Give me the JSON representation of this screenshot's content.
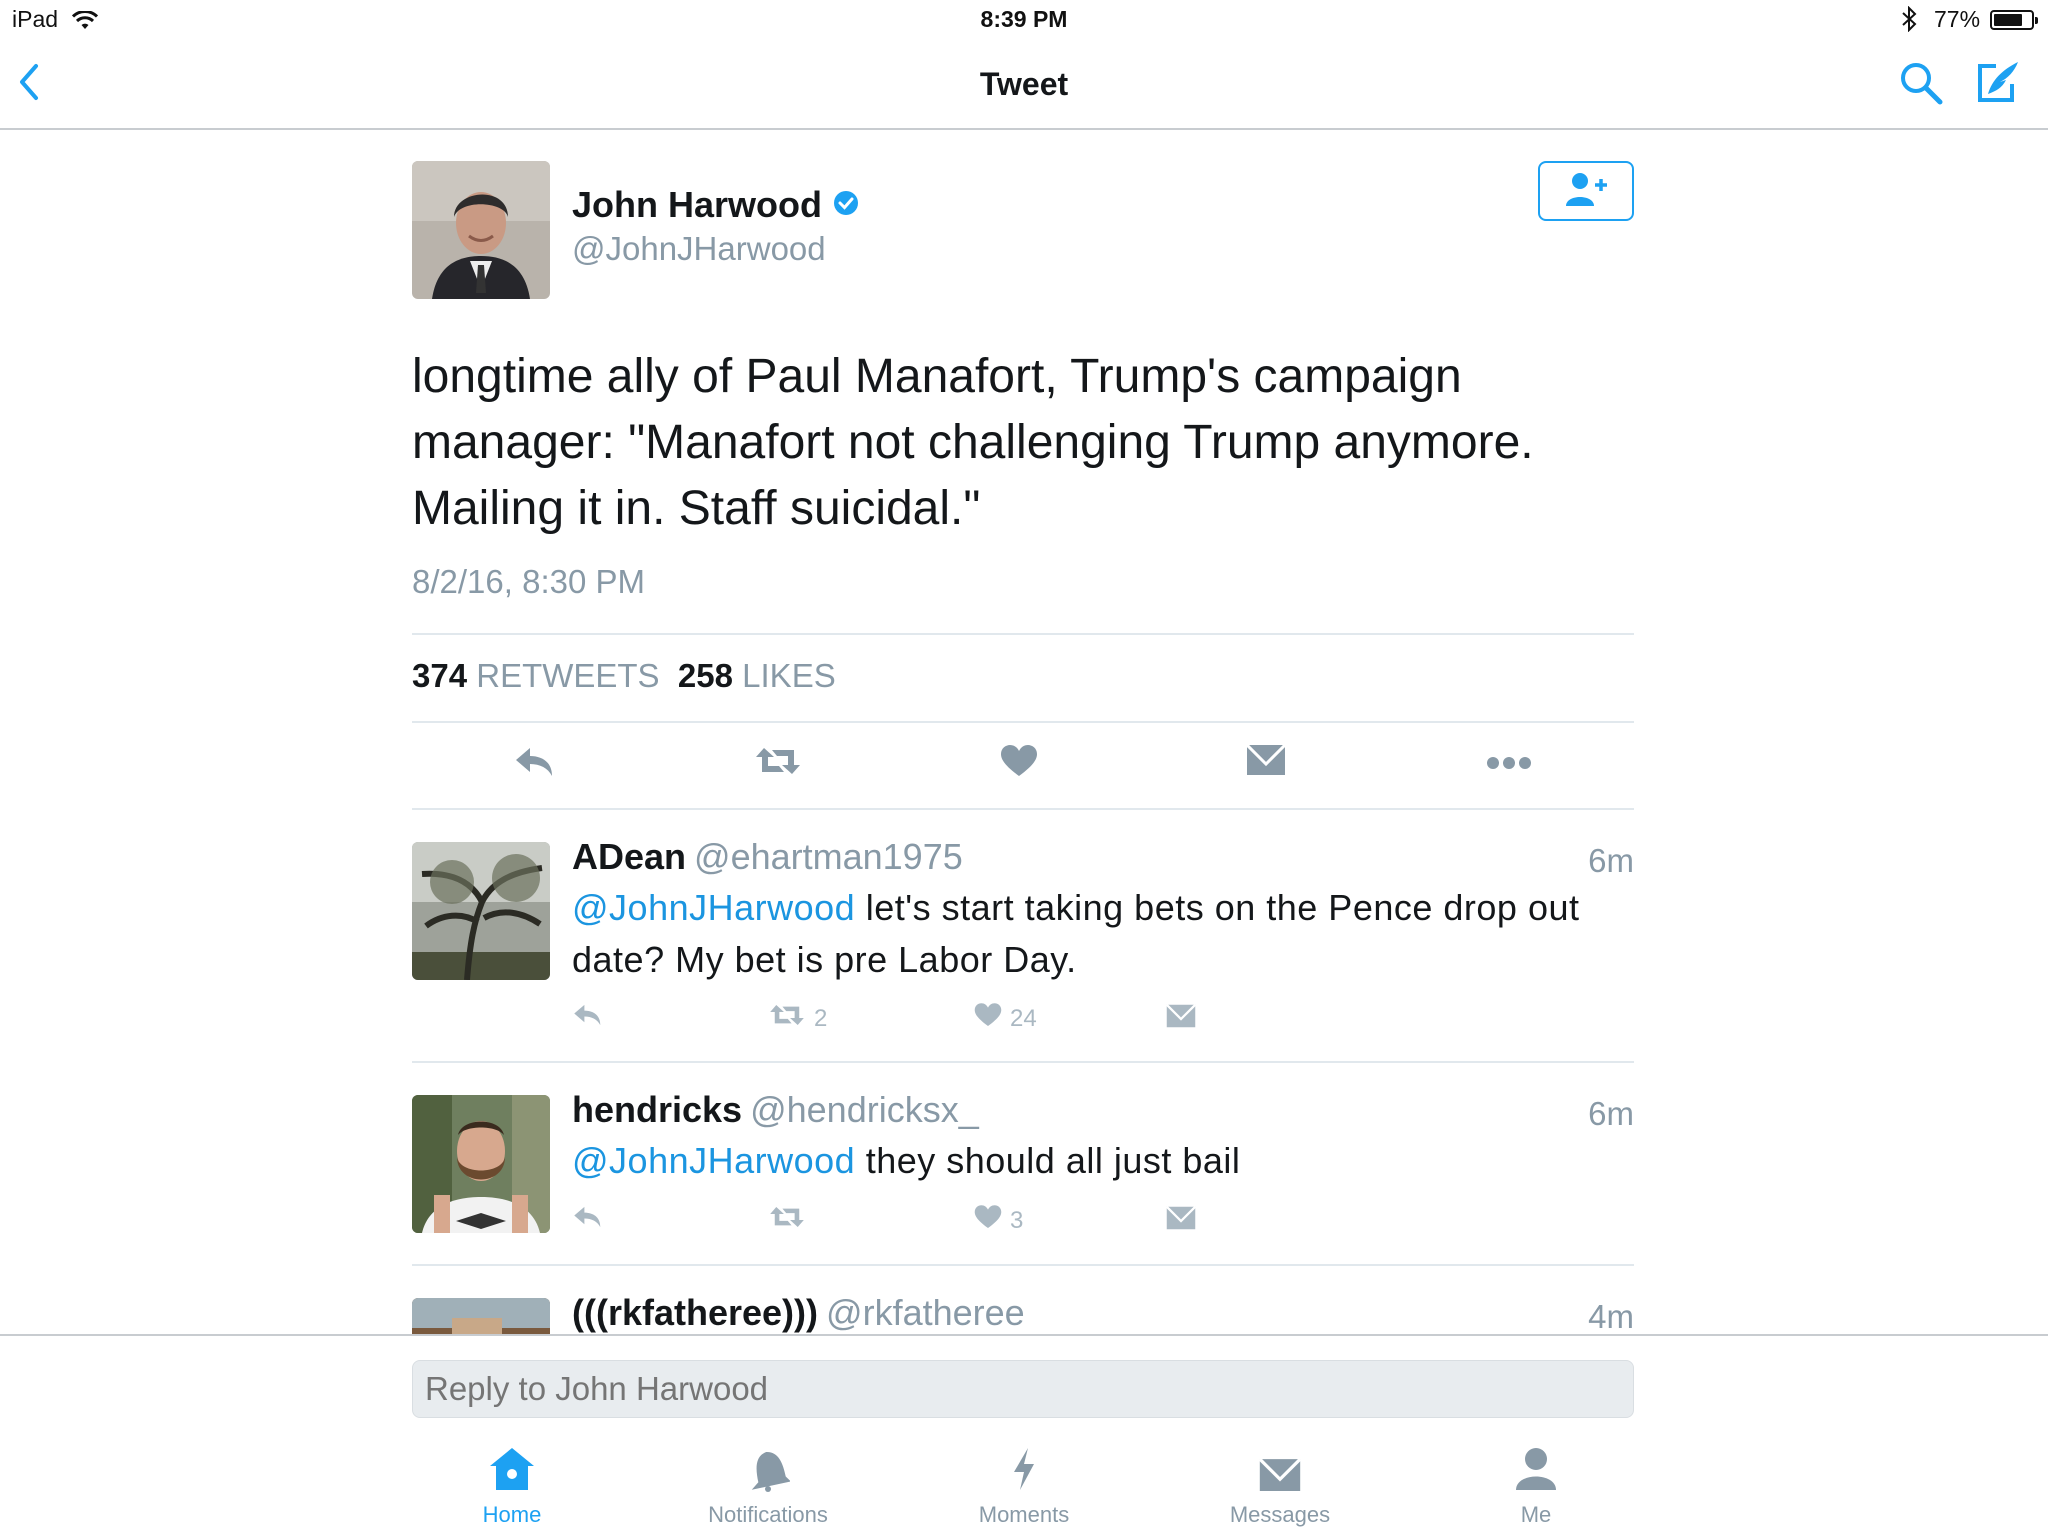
{
  "status_bar": {
    "device": "iPad",
    "time": "8:39 PM",
    "battery_pct": "77%",
    "battery_level": 0.77
  },
  "nav": {
    "title": "Tweet"
  },
  "tweet": {
    "author_name": "John Harwood",
    "author_handle": "@JohnJHarwood",
    "text": "longtime ally of Paul Manafort, Trump's campaign manager: \"Manafort not challenging Trump anymore. Mailing it in. Staff suicidal.\"",
    "timestamp": "8/2/16, 8:30 PM",
    "retweets_count": "374",
    "retweets_label": "RETWEETS",
    "likes_count": "258",
    "likes_label": "LIKES"
  },
  "replies": [
    {
      "name": "ADean",
      "handle": "@ehartman1975",
      "time": "6m",
      "mention": "@JohnJHarwood",
      "text": " let's start taking bets on the Pence drop out date? My bet is pre Labor Day.",
      "retweets": "2",
      "likes": "24"
    },
    {
      "name": "hendricks",
      "handle": "@hendricksx_",
      "time": "6m",
      "mention": "@JohnJHarwood",
      "text": " they should all just bail",
      "retweets": "",
      "likes": "3"
    },
    {
      "name": "(((rkfatheree)))",
      "handle": "@rkfatheree",
      "time": "4m"
    }
  ],
  "reply_box": {
    "placeholder": "Reply to John Harwood"
  },
  "tabs": [
    {
      "label": "Home"
    },
    {
      "label": "Notifications"
    },
    {
      "label": "Moments"
    },
    {
      "label": "Messages"
    },
    {
      "label": "Me"
    }
  ],
  "colors": {
    "accent": "#1da1f2",
    "mention": "#1b95e0",
    "muted": "#8899a6",
    "text": "#14171a"
  },
  "icons": [
    "back-chevron-icon",
    "search-icon",
    "compose-icon",
    "verified-icon",
    "follow-icon",
    "reply-icon",
    "retweet-icon",
    "like-icon",
    "direct-message-icon",
    "more-icon",
    "home-icon",
    "notifications-icon",
    "moments-icon",
    "messages-icon",
    "me-icon"
  ]
}
